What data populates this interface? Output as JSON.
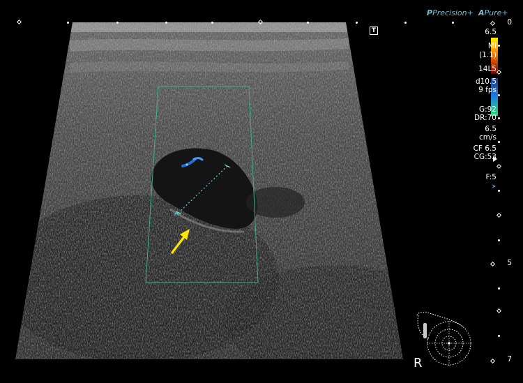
{
  "brand": {
    "precision": "Precision+",
    "pure": "Pure+",
    "precision_icon": "P",
    "pure_icon": "A"
  },
  "params": {
    "freq_top": "6.5",
    "mi": "MI",
    "mi_val": "(1.1)",
    "probe": "14L5",
    "depth_line": "d10.5",
    "fps": "9 fps",
    "gain": "G:92",
    "dr": "DR:70",
    "scale": "6.5",
    "scale_unit": "cm/s",
    "cf": "CF 6.5",
    "cg": "CG:53",
    "focus": "F:5"
  },
  "depth_scale": {
    "top": "0",
    "mid": "5",
    "bottom": "7"
  },
  "markers": {
    "t_marker": "T",
    "orientation": "R",
    "cursor_label": "A"
  },
  "colors": {
    "arrow": "#ffe600",
    "color_box": "#3fae8a",
    "caliper": "#5fd6d6",
    "brand": "#7fb9cf",
    "focus_marker": "#5fb6e0"
  },
  "icons": [
    "t-marker-icon",
    "color-scale-bar",
    "focus-marker-icon",
    "probe-orientation-icon",
    "arrow-annotation-icon"
  ]
}
